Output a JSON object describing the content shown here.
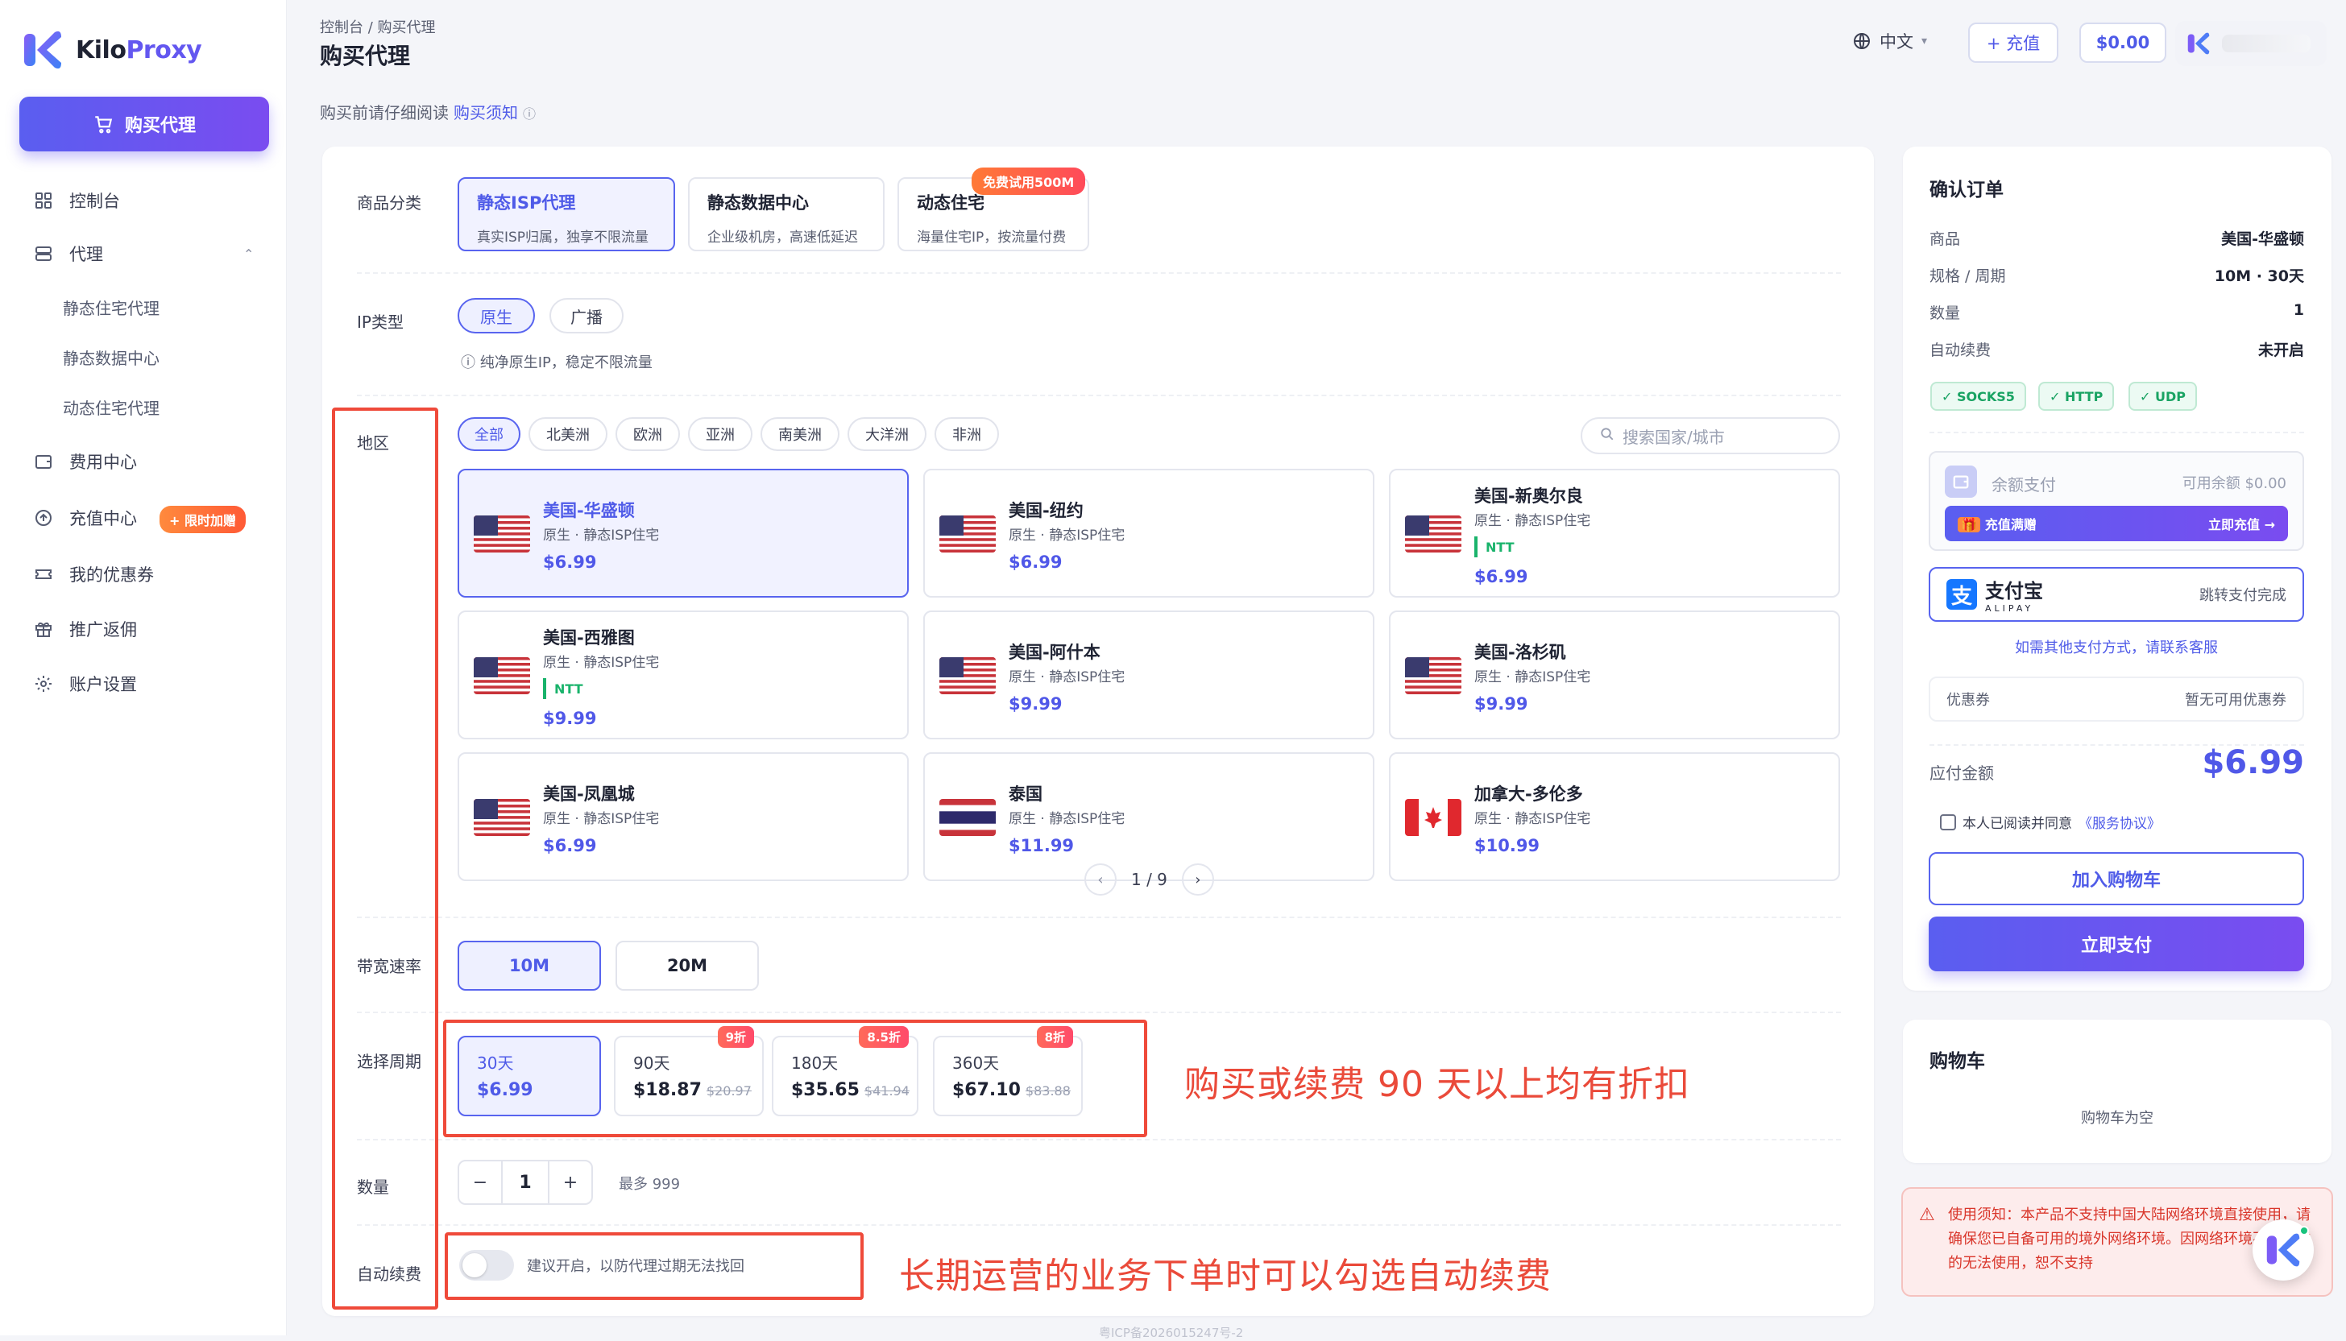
{
  "brand": {
    "name_a": "Kilo",
    "name_b": "Proxy"
  },
  "sidebar": {
    "buy_button": "购买代理",
    "items": [
      {
        "label": "控制台",
        "icon": "grid-icon"
      },
      {
        "label": "代理",
        "icon": "server-icon"
      },
      {
        "label": "静态住宅代理"
      },
      {
        "label": "静态数据中心"
      },
      {
        "label": "动态住宅代理"
      },
      {
        "label": "费用中心",
        "icon": "wallet-icon"
      },
      {
        "label": "充值中心",
        "icon": "recharge-icon",
        "badge": "+ 限时加赠"
      },
      {
        "label": "我的优惠券",
        "icon": "ticket-icon"
      },
      {
        "label": "推广返佣",
        "icon": "gift-icon"
      },
      {
        "label": "账户设置",
        "icon": "gear-icon"
      }
    ]
  },
  "header": {
    "breadcrumb": "控制台 / 购买代理",
    "title": "购买代理",
    "language": "中文",
    "recharge": "+ 充值",
    "balance": "$0.00"
  },
  "notice": {
    "text": "购买前请仔细阅读",
    "link": "购买须知"
  },
  "form": {
    "labels": {
      "category": "商品分类",
      "ip_type": "IP类型",
      "region": "地区",
      "bandwidth": "带宽速率",
      "period": "选择周期",
      "quantity": "数量",
      "autorenew": "自动续费"
    },
    "categories": [
      {
        "title": "静态ISP代理",
        "desc": "真实ISP归属，独享不限流量",
        "selected": true
      },
      {
        "title": "静态数据中心",
        "desc": "企业级机房，高速低延迟"
      },
      {
        "title": "动态住宅",
        "desc": "海量住宅IP，按流量付费",
        "badge": "免费试用500M"
      }
    ],
    "ip_types": [
      "原生",
      "广播"
    ],
    "ip_hint": "纯净原生IP，稳定不限流量",
    "region_tabs": [
      "全部",
      "北美洲",
      "欧洲",
      "亚洲",
      "南美洲",
      "大洋洲",
      "非洲"
    ],
    "search_placeholder": "搜索国家/城市",
    "regions": [
      {
        "name": "美国-华盛顿",
        "desc": "原生 · 静态ISP住宅",
        "price": "$6.99",
        "flag": "us",
        "selected": true
      },
      {
        "name": "美国-纽约",
        "desc": "原生 · 静态ISP住宅",
        "price": "$6.99",
        "flag": "us"
      },
      {
        "name": "美国-新奥尔良",
        "desc": "原生 · 静态ISP住宅",
        "price": "$6.99",
        "flag": "us",
        "tag": "NTT"
      },
      {
        "name": "美国-西雅图",
        "desc": "原生 · 静态ISP住宅",
        "price": "$9.99",
        "flag": "us",
        "tag": "NTT"
      },
      {
        "name": "美国-阿什本",
        "desc": "原生 · 静态ISP住宅",
        "price": "$9.99",
        "flag": "us"
      },
      {
        "name": "美国-洛杉矶",
        "desc": "原生 · 静态ISP住宅",
        "price": "$9.99",
        "flag": "us"
      },
      {
        "name": "美国-凤凰城",
        "desc": "原生 · 静态ISP住宅",
        "price": "$6.99",
        "flag": "us"
      },
      {
        "name": "泰国",
        "desc": "原生 · 静态ISP住宅",
        "price": "$11.99",
        "flag": "th"
      },
      {
        "name": "加拿大-多伦多",
        "desc": "原生 · 静态ISP住宅",
        "price": "$10.99",
        "flag": "ca"
      }
    ],
    "pager": "1 / 9",
    "bandwidths": [
      "10M",
      "20M"
    ],
    "periods": [
      {
        "days": "30天",
        "price": "$6.99",
        "selected": true
      },
      {
        "days": "90天",
        "price": "$18.87",
        "orig": "$20.97",
        "discount": "9折"
      },
      {
        "days": "180天",
        "price": "$35.65",
        "orig": "$41.94",
        "discount": "8.5折"
      },
      {
        "days": "360天",
        "price": "$67.10",
        "orig": "$83.88",
        "discount": "8折"
      }
    ],
    "quantity": {
      "minus": "−",
      "value": "1",
      "plus": "+",
      "max": "最多 999"
    },
    "autorenew_hint": "建议开启，以防代理过期无法找回"
  },
  "annotations": {
    "discount_note": "购买或续费 90 天以上均有折扣",
    "renew_note": "长期运营的业务下单时可以勾选自动续费"
  },
  "order": {
    "title": "确认订单",
    "rows": [
      {
        "k": "商品",
        "v": "美国-华盛顿"
      },
      {
        "k": "规格 / 周期",
        "v": "10M · 30天"
      },
      {
        "k": "数量",
        "v": "1"
      },
      {
        "k": "自动续费",
        "v": "未开启"
      }
    ],
    "protocols": [
      "✓ SOCKS5",
      "✓ HTTP",
      "✓ UDP"
    ],
    "balance_pay": "余额支付",
    "balance_avail": "可用余额 $0.00",
    "recharge_banner": "充值满赠",
    "recharge_now": "立即充值 →",
    "alipay_name": "支付宝",
    "alipay_sub": "ALIPAY",
    "alipay_note": "跳转支付完成",
    "other_pay": "如需其他支付方式，请联系客服",
    "coupon": "优惠券",
    "coupon_val": "暂无可用优惠券",
    "due_label": "应付金额",
    "due": "$6.99",
    "agree": "本人已阅读并同意",
    "agree_link": "《服务协议》",
    "add_cart": "加入购物车",
    "pay_now": "立即支付"
  },
  "cart": {
    "title": "购物车",
    "empty": "购物车为空"
  },
  "warning": "使用须知：本产品不支持中国大陆网络环境直接使用，请确保您已自备可用的境外网络环境。因网络环境不符导致的无法使用，恕不支持",
  "footer": "粤ICP备2026015247号-2",
  "colors": {
    "accent": "#5864ef",
    "price": "#5058e8",
    "ntt": "#19b36b",
    "annotation": "#ea4a3a"
  }
}
